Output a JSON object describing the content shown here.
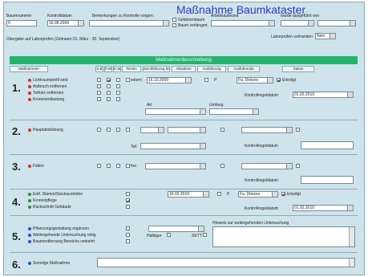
{
  "title": "Maßnahme Baumkataster",
  "top": {
    "baumnummer_label": "Baumnummer",
    "baumnummer_value": "0",
    "kontrolldatum_label": "Kontrolldatum",
    "kontrolldatum_value": "16.08.2009",
    "bemerkungen_label": "Bemerkungen zu Kontrolle vorgen.",
    "arbeitsaufwand_label": "Arbeitsaufwand",
    "arbeitsaufwand_value": "",
    "wurde_ausgefuehrt_label": "wurde ausgeführt von",
    "wurde_ausgefuehrt_value": "",
    "gefahrenbaum_label": "Gefahrenbaum",
    "baumverluebel_label": "Baum verlängert",
    "uebergabe_text": "Übergabe auf Laborprüfen (Zeitraum 01. März - 30. September)",
    "laborpruefen_label": "Laborprüfen vorhanden",
    "laborpruefen_value": "Nein"
  },
  "banner": "Maßnahmenbeschreibung",
  "headers": [
    "Maßnahmen",
    "S.B",
    "P.W",
    "K.W",
    "Termin",
    "durchführung bis",
    "Abnahme",
    "Ausführung",
    "Ausführende",
    "Status"
  ],
  "sections": {
    "s1": {
      "num": "1.",
      "items": [
        "Lichtraumprofil sind",
        "Astbruch entfernen",
        "Totholz entfernen",
        "Kronenentlastung"
      ],
      "date": "16.10.2009",
      "checkbox_p": "P",
      "firma": "Fa. Dietzes",
      "status_check": "Erledigt",
      "kontroll_label": "Kontrollregeldatum",
      "kontroll_value": "01.02.2010",
      "art_label": "Art",
      "umfang_label": "Umfang",
      "extra_label": "extern"
    },
    "s2": {
      "num": "2.",
      "items": [
        "Hauptabstützung"
      ],
      "teil_label": "Teil",
      "kontroll_label": "Kontrollregeldatum"
    },
    "s3": {
      "num": "3.",
      "items": [
        "Fällen"
      ],
      "frei_label": "frei",
      "kontroll_label": "Kontrollregeldatum"
    },
    "s4": {
      "num": "4.",
      "items": [
        "Entf. Stamm/Stockaustriebe",
        "Kronenpflege",
        "Rückschnitt Gebäude"
      ],
      "date": "16.02.2010",
      "checkbox_p": "P",
      "firma": "Fa. Dietzes",
      "status_check": "Erledigt",
      "kontroll_label": "Kontrollregeldatum",
      "kontroll_value": "01.02.2010"
    },
    "s5": {
      "num": "5.",
      "items": [
        "Pflanzungsgestaltung ergänzen",
        "Weitergehende Untersuchung nötig",
        "Baumentfernung Bereichs verkehrt"
      ],
      "hinweis_label": "Hinweis zur weitergehenden Untersuchung",
      "haelbiger_label": "Halbiger",
      "sktt_label": "SKTT"
    },
    "s6": {
      "num": "6.",
      "items": [
        "Sonstige Maßnahme"
      ]
    }
  }
}
